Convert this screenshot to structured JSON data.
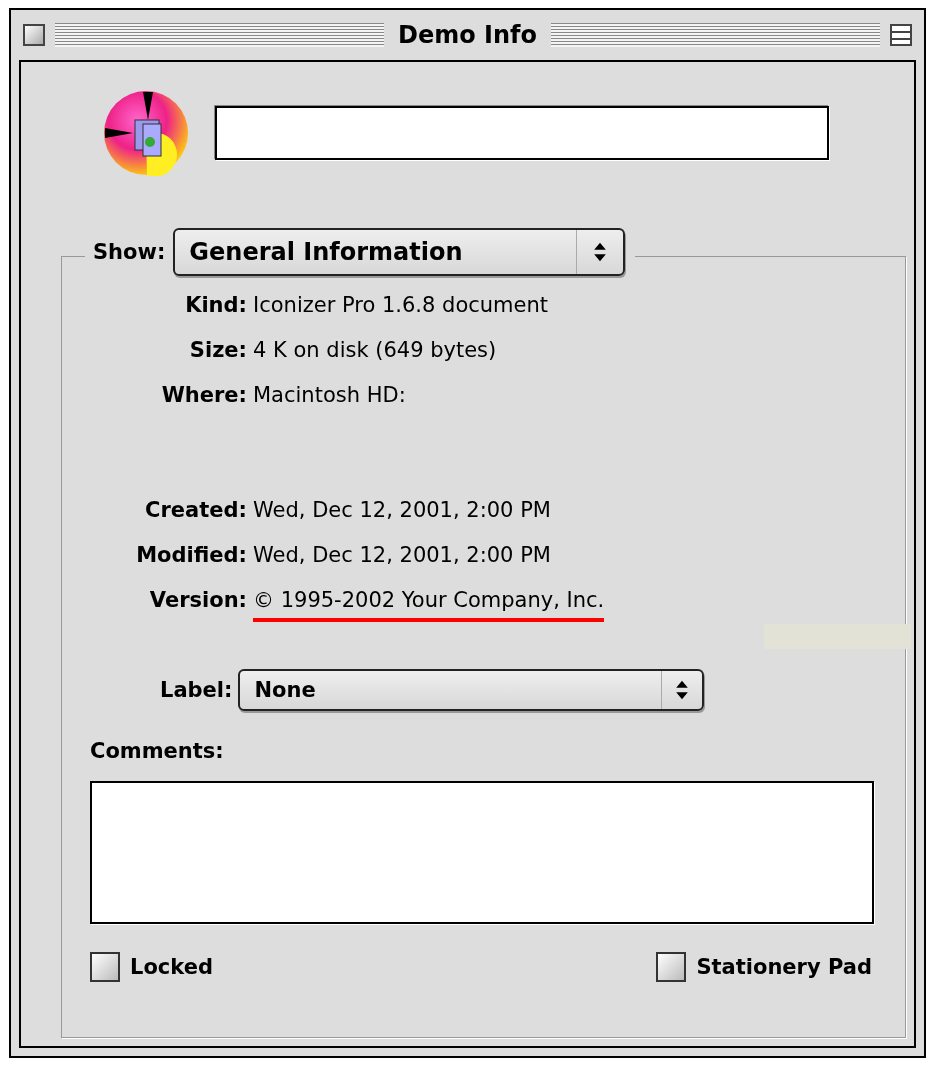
{
  "window": {
    "title": "Demo Info"
  },
  "show": {
    "label": "Show:",
    "value": "General Information"
  },
  "location_info": [
    {
      "label": "Kind:",
      "value": "Iconizer Pro 1.6.8 document",
      "underlined": false
    },
    {
      "label": "Size:",
      "value": "4 K on disk (649 bytes)",
      "underlined": false
    },
    {
      "label": "Where:",
      "value": "Macintosh HD:",
      "underlined": false
    }
  ],
  "date_info": [
    {
      "label": "Created:",
      "value": "Wed, Dec 12, 2001, 2:00 PM",
      "underlined": false
    },
    {
      "label": "Modified:",
      "value": "Wed, Dec 12, 2001, 2:00 PM",
      "underlined": false
    },
    {
      "label": "Version:",
      "value": "© 1995-2002 Your Company, Inc.",
      "underlined": true
    }
  ],
  "label_menu": {
    "label": "Label:",
    "value": "None"
  },
  "comments": {
    "label": "Comments:"
  },
  "checkboxes": [
    {
      "label": "Locked",
      "checked": false
    },
    {
      "label": "Stationery Pad",
      "checked": false
    }
  ]
}
